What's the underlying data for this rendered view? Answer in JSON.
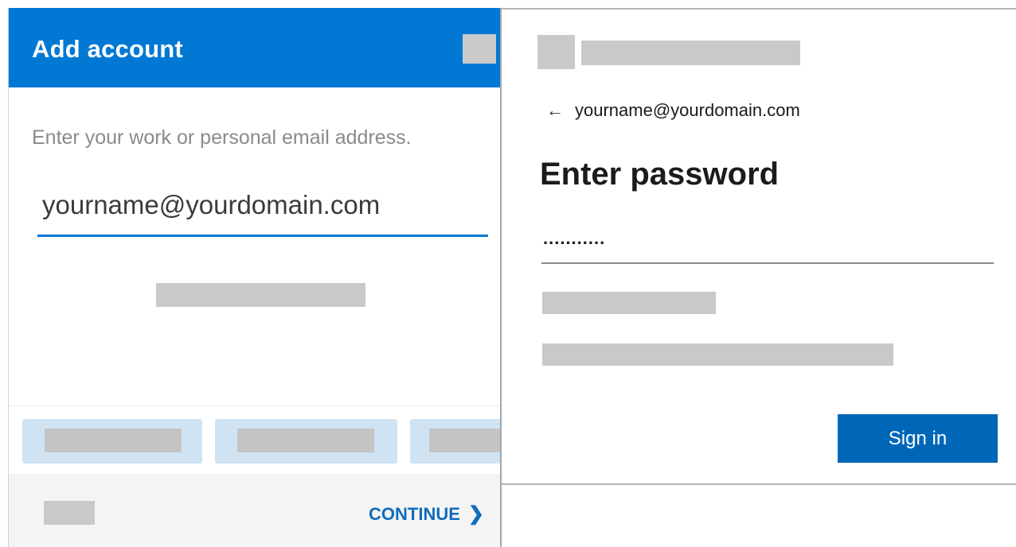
{
  "left_panel": {
    "title": "Add account",
    "instruction": "Enter your work or personal email address.",
    "email_value": "yourname@yourdomain.com",
    "continue_label": "CONTINUE",
    "continue_icon": "chevron-right-icon",
    "accent_color": "#0078d4"
  },
  "right_panel": {
    "back_icon": "arrow-left-icon",
    "identity": "yourname@yourdomain.com",
    "title": "Enter password",
    "password_mask": "...........",
    "signin_label": "Sign in",
    "button_color": "#0067b8"
  }
}
